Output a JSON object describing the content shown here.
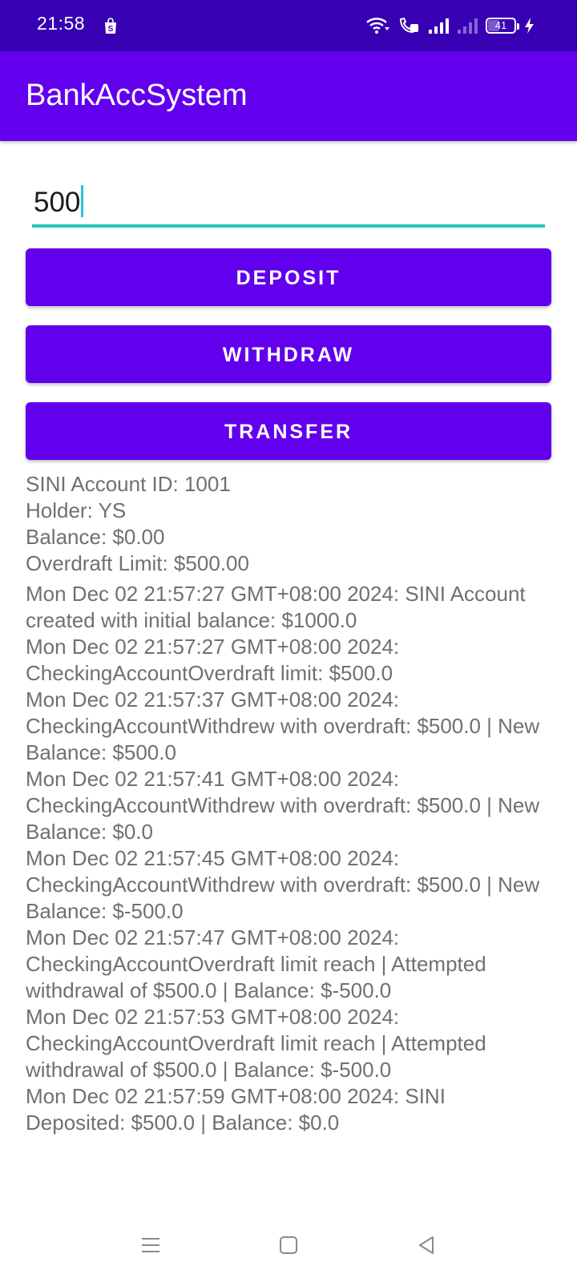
{
  "status_bar": {
    "time": "21:58",
    "battery_level": "41",
    "icons": [
      "shopping-bag-icon",
      "wifi-icon",
      "volte-call-icon",
      "signal-icon",
      "signal-weak-icon",
      "battery-icon",
      "charging-icon"
    ]
  },
  "app_bar": {
    "title": "BankAccSystem"
  },
  "amount_input": {
    "value": "500",
    "accent_color": "#26c6b6"
  },
  "buttons": {
    "deposit": "DEPOSIT",
    "withdraw": "WITHDRAW",
    "transfer": "TRANSFER",
    "color": "#6200ee"
  },
  "account": {
    "id_line": "SINI Account ID: 1001",
    "holder_line": "Holder: YS",
    "balance_line": "Balance: $0.00",
    "overdraft_line": "Overdraft Limit: $500.00"
  },
  "history": [
    "Mon Dec 02 21:57:27 GMT+08:00 2024: SINI Account created with initial balance: $1000.0",
    "Mon Dec 02 21:57:27 GMT+08:00 2024: CheckingAccountOverdraft limit: $500.0",
    "Mon Dec 02 21:57:37 GMT+08:00 2024: CheckingAccountWithdrew with overdraft: $500.0 | New Balance: $500.0",
    "Mon Dec 02 21:57:41 GMT+08:00 2024: CheckingAccountWithdrew with overdraft: $500.0 | New Balance: $0.0",
    "Mon Dec 02 21:57:45 GMT+08:00 2024: CheckingAccountWithdrew with overdraft: $500.0 | New Balance: $-500.0",
    "Mon Dec 02 21:57:47 GMT+08:00 2024: CheckingAccountOverdraft limit reach | Attempted withdrawal of $500.0 | Balance: $-500.0",
    "Mon Dec 02 21:57:53 GMT+08:00 2024: CheckingAccountOverdraft limit reach | Attempted withdrawal of $500.0 | Balance: $-500.0",
    "Mon Dec 02 21:57:59 GMT+08:00 2024: SINI Deposited: $500.0 | Balance: $0.0"
  ],
  "nav_bar": {
    "icons": [
      "menu-icon",
      "home-square-icon",
      "back-triangle-icon"
    ]
  }
}
